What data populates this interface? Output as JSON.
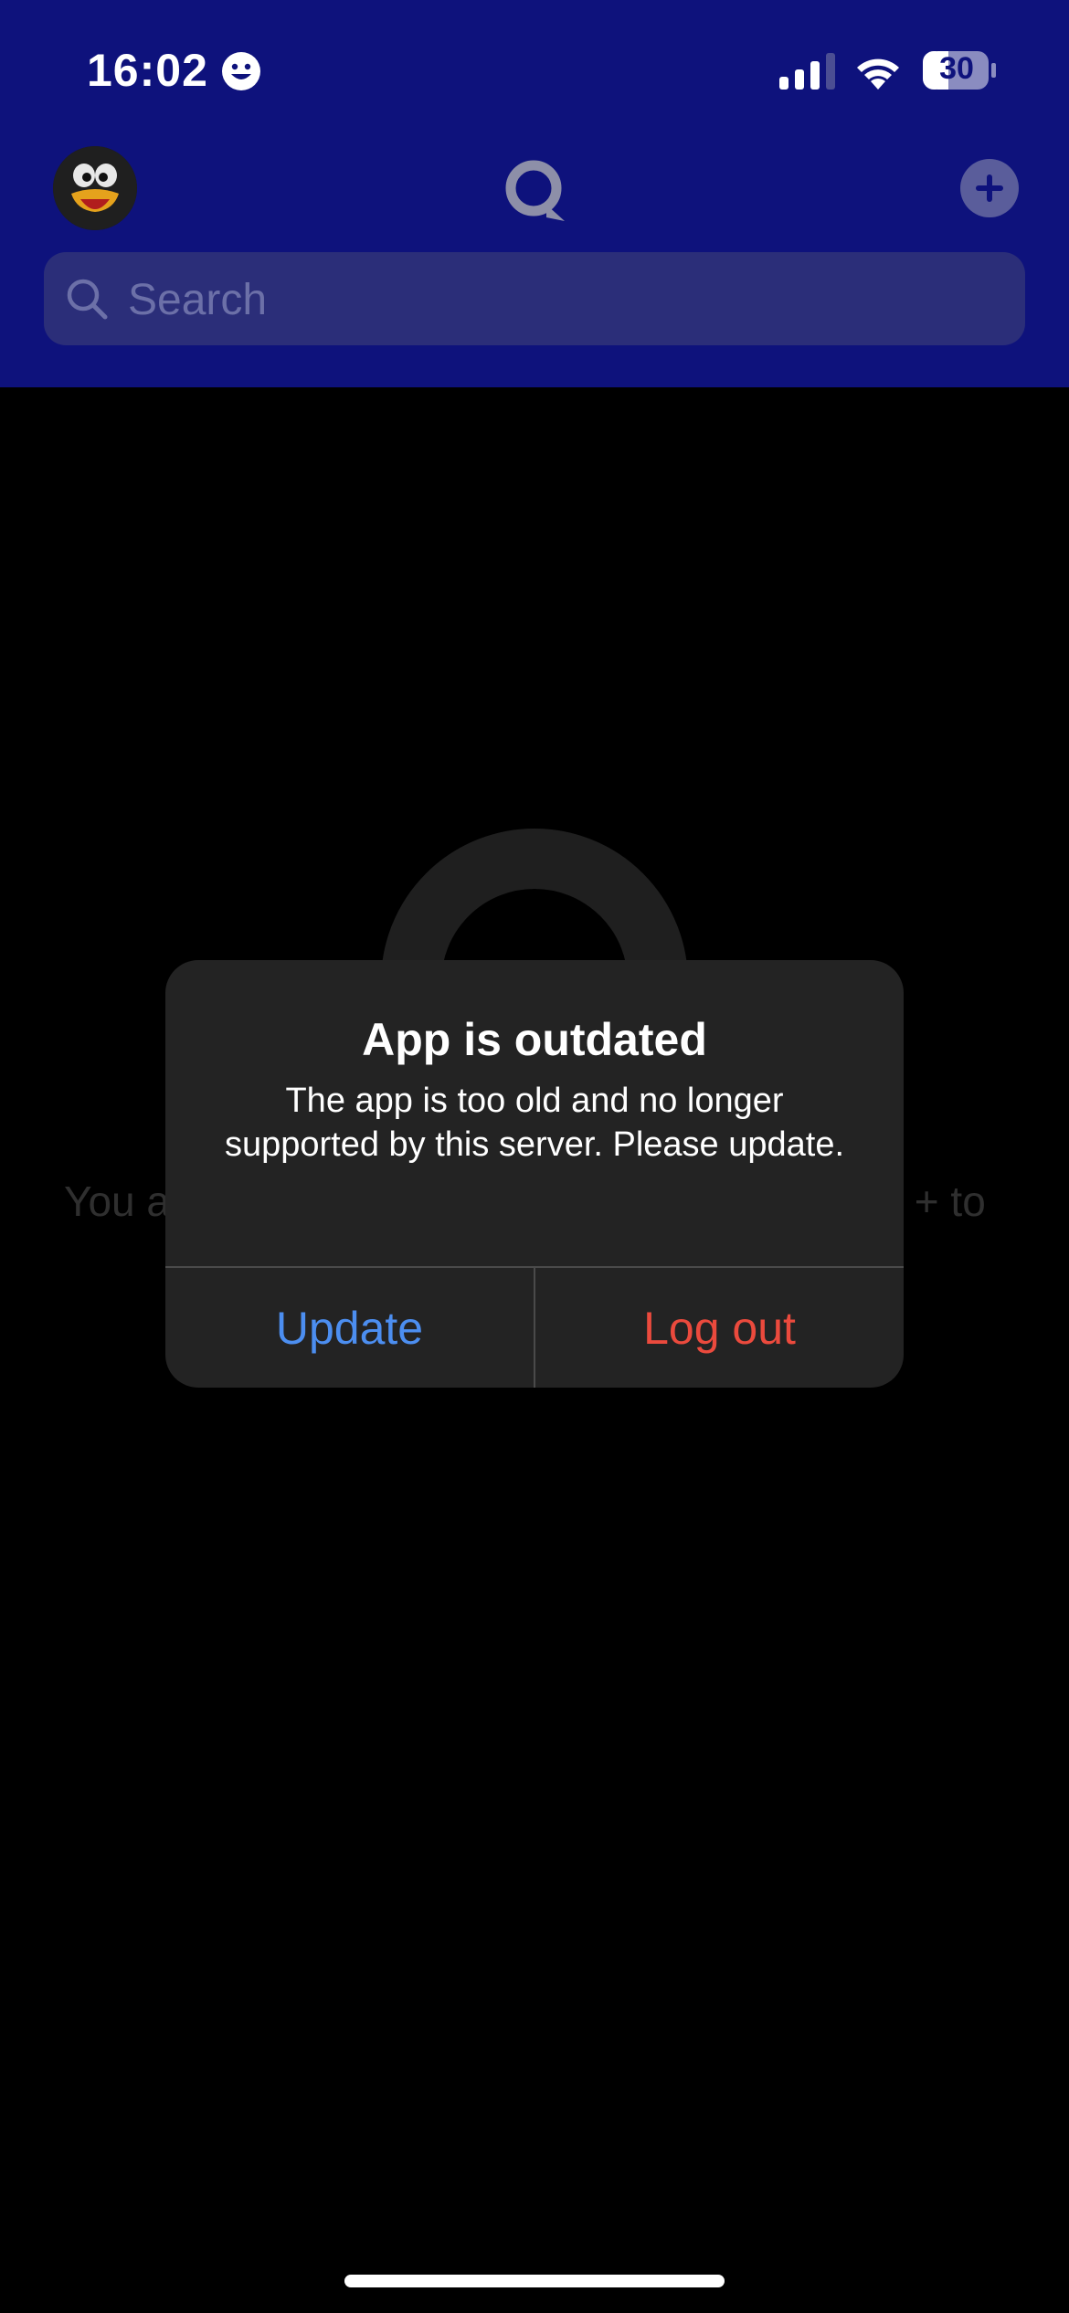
{
  "status_bar": {
    "time": "16:02",
    "battery_level": "30"
  },
  "header": {
    "avatar_icon": "penguin-avatar",
    "logo_icon": "app-logo-icon",
    "add_icon": "plus-icon",
    "search": {
      "placeholder": "Search",
      "value": ""
    }
  },
  "empty_state": {
    "hint_visible_left": "You a",
    "hint_visible_right": "s + to"
  },
  "dialog": {
    "title": "App is outdated",
    "message": "The app is too old and no longer supported by this server. Please update.",
    "update_label": "Update",
    "logout_label": "Log out"
  },
  "colors": {
    "header_bg": "#0e127c",
    "search_bg": "#2b2e79",
    "dialog_bg": "#232323",
    "update_color": "#4c8ef0",
    "logout_color": "#eb4a3d"
  }
}
